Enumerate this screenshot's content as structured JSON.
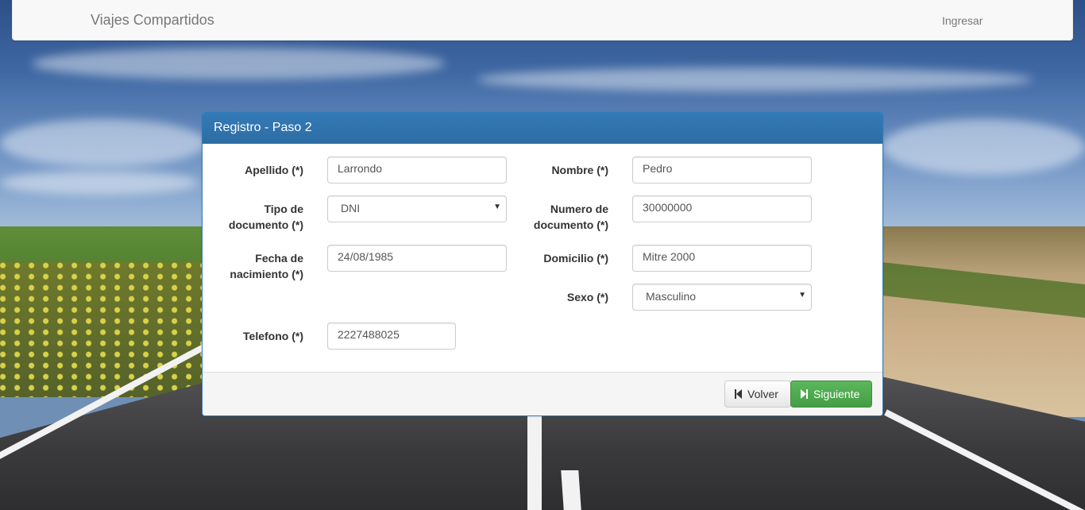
{
  "navbar": {
    "brand": "Viajes Compartidos",
    "login_link": "Ingresar"
  },
  "panel": {
    "title": "Registro - Paso 2",
    "fields": {
      "apellido": {
        "label": "Apellido (*)",
        "value": "Larrondo"
      },
      "nombre": {
        "label": "Nombre (*)",
        "value": "Pedro"
      },
      "tipo_documento": {
        "label_line1": "Tipo de",
        "label_line2": "documento (*)",
        "value": "DNI"
      },
      "numero_documento": {
        "label_line1": "Numero de",
        "label_line2": "documento (*)",
        "value": "30000000"
      },
      "fecha_nacimiento": {
        "label_line1": "Fecha de",
        "label_line2": "nacimiento (*)",
        "value": "24/08/1985"
      },
      "domicilio": {
        "label": "Domicilio (*)",
        "value": "Mitre 2000"
      },
      "sexo": {
        "label": "Sexo (*)",
        "value": "Masculino"
      },
      "telefono": {
        "label": "Telefono (*)",
        "value": "2227488025"
      }
    },
    "buttons": {
      "back": "Volver",
      "next": "Siguiente"
    }
  },
  "colors": {
    "primary": "#337ab7",
    "success": "#5cb85c",
    "navbar_bg": "#f8f8f8"
  }
}
